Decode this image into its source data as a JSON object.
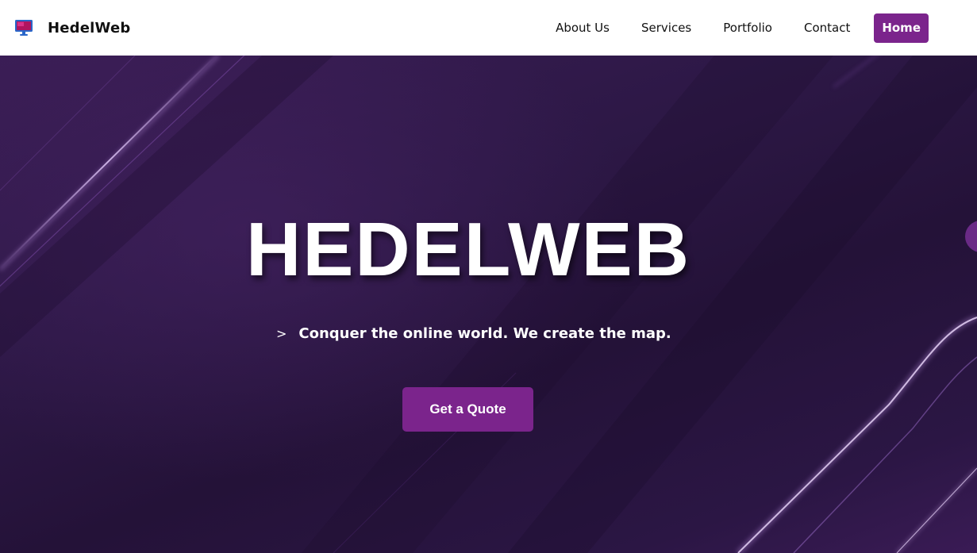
{
  "brand": {
    "name": "HedelWeb",
    "logo_icon": "monitor-icon"
  },
  "nav": {
    "items": [
      {
        "label": "About Us"
      },
      {
        "label": "Services"
      },
      {
        "label": "Portfolio"
      },
      {
        "label": "Contact"
      }
    ],
    "active": {
      "label": "Home"
    }
  },
  "hero": {
    "title": "HEDELWEB",
    "tagline_arrow": ">",
    "tagline": "Conquer the online world. We create the map.",
    "cta_label": "Get a Quote"
  },
  "colors": {
    "accent": "#7b248c",
    "hero_bg": "#2a1843",
    "navbar_bg": "#ffffff"
  }
}
